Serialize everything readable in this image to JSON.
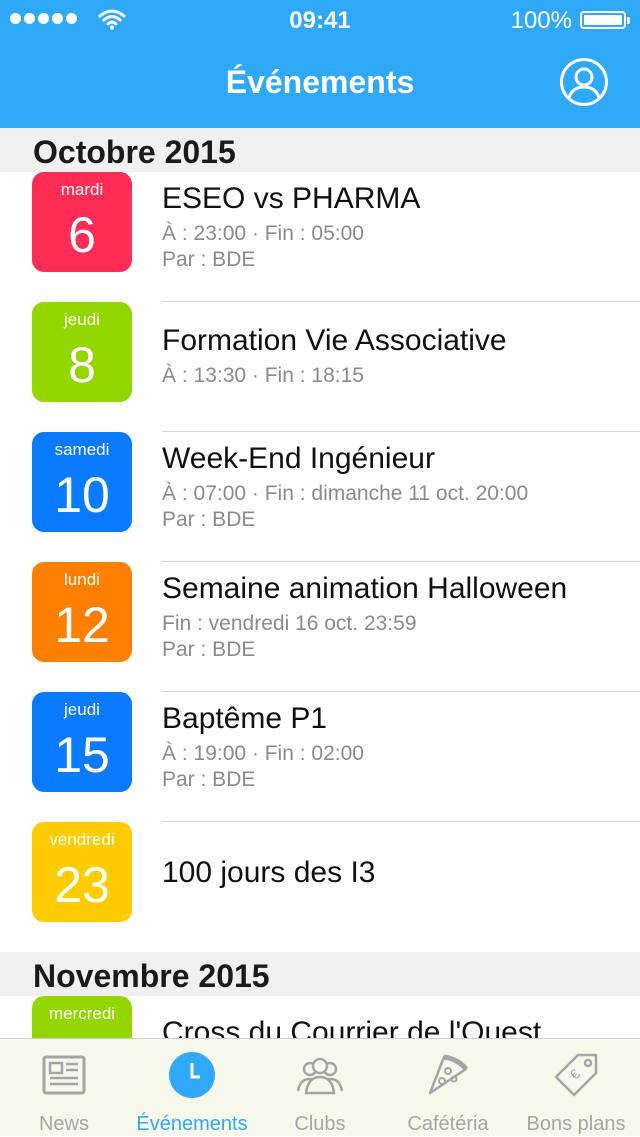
{
  "status_bar": {
    "time": "09:41",
    "battery": "100%",
    "battery_level": 1.0
  },
  "nav": {
    "title": "Événements"
  },
  "sections": [
    {
      "title": "Octobre 2015",
      "events": [
        {
          "weekday": "mardi",
          "day": "6",
          "color": "#ff2d55",
          "title": "ESEO vs PHARMA",
          "line1": "À : 23:00  ·  Fin : 05:00",
          "line2": "Par : BDE"
        },
        {
          "weekday": "jeudi",
          "day": "8",
          "color": "#94d600",
          "title": "Formation Vie Associative",
          "line1": "À : 13:30  ·  Fin : 18:15",
          "line2": ""
        },
        {
          "weekday": "samedi",
          "day": "10",
          "color": "#0a7bff",
          "title": "Week-End Ingénieur",
          "line1": "À : 07:00  ·  Fin : dimanche 11 oct. 20:00",
          "line2": "Par : BDE"
        },
        {
          "weekday": "lundi",
          "day": "12",
          "color": "#ff7f00",
          "title": "Semaine animation Halloween",
          "line1": "Fin : vendredi 16 oct. 23:59",
          "line2": "Par : BDE"
        },
        {
          "weekday": "jeudi",
          "day": "15",
          "color": "#0a7bff",
          "title": "Baptême P1",
          "line1": "À : 19:00  ·  Fin : 02:00",
          "line2": "Par : BDE"
        },
        {
          "weekday": "vendredi",
          "day": "23",
          "color": "#ffcc00",
          "title": "100 jours des I3",
          "line1": "",
          "line2": ""
        }
      ]
    },
    {
      "title": "Novembre 2015",
      "events": [
        {
          "weekday": "mercredi",
          "day": "",
          "color": "#94d600",
          "title": "Cross du Courrier de l'Ouest",
          "line1": "",
          "line2": ""
        }
      ]
    }
  ],
  "tabbar": {
    "active_color": "#2ea8f7",
    "items": [
      {
        "label": "News",
        "icon": "newspaper-icon"
      },
      {
        "label": "Événements",
        "icon": "clock-icon",
        "active": true
      },
      {
        "label": "Clubs",
        "icon": "people-icon"
      },
      {
        "label": "Cafétéria",
        "icon": "pizza-icon"
      },
      {
        "label": "Bons plans",
        "icon": "tag-icon"
      }
    ]
  }
}
